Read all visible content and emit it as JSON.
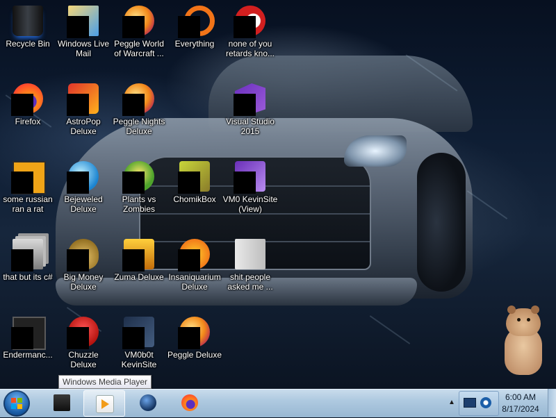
{
  "desktop": {
    "icons": [
      {
        "label_lines": [
          "Recycle Bin"
        ],
        "icon": "recycle-bin-icon"
      },
      {
        "label_lines": [
          "Windows Live",
          "Mail"
        ],
        "icon": "windows-live-mail-icon"
      },
      {
        "label_lines": [
          "Peggle World",
          "of Warcraft ..."
        ],
        "icon": "peggle-icon"
      },
      {
        "label_lines": [
          "Everything"
        ],
        "icon": "everything-search-icon"
      },
      {
        "label_lines": [
          "none of you",
          "retards kno..."
        ],
        "icon": "shortcut-icon"
      },
      {
        "label_lines": [
          "Firefox"
        ],
        "icon": "firefox-icon"
      },
      {
        "label_lines": [
          "AstroPop",
          "Deluxe"
        ],
        "icon": "astropop-icon"
      },
      {
        "label_lines": [
          "Peggle Nights",
          "Deluxe"
        ],
        "icon": "peggle-nights-icon"
      },
      {
        "label_lines": [
          "Visual Studio",
          "2015"
        ],
        "icon": "visual-studio-icon"
      },
      {
        "label_lines": [
          "some russian",
          "ran a rat"
        ],
        "icon": "file-icon"
      },
      {
        "label_lines": [
          "Bejeweled",
          "Deluxe"
        ],
        "icon": "bejeweled-icon"
      },
      {
        "label_lines": [
          "Plants vs",
          "Zombies"
        ],
        "icon": "plants-vs-zombies-icon"
      },
      {
        "label_lines": [
          "ChomikBox"
        ],
        "icon": "chomikbox-icon"
      },
      {
        "label_lines": [
          "VM0 KevinSite",
          "(View)"
        ],
        "icon": "vm-icon"
      },
      {
        "label_lines": [
          "that but its c#"
        ],
        "icon": "stacked-files-icon"
      },
      {
        "label_lines": [
          "Big Money",
          "Deluxe"
        ],
        "icon": "big-money-icon"
      },
      {
        "label_lines": [
          "Zuma Deluxe"
        ],
        "icon": "zuma-icon"
      },
      {
        "label_lines": [
          "Insaniquarium",
          "Deluxe"
        ],
        "icon": "insaniquarium-icon"
      },
      {
        "label_lines": [
          "shit people",
          "asked me ..."
        ],
        "icon": "folder-icon"
      },
      {
        "label_lines": [
          "Endermanc..."
        ],
        "icon": "console-icon"
      },
      {
        "label_lines": [
          "Chuzzle",
          "Deluxe"
        ],
        "icon": "chuzzle-icon"
      },
      {
        "label_lines": [
          "VM0b0t",
          "KevinSite"
        ],
        "icon": "vm-icon"
      },
      {
        "label_lines": [
          "Peggle Deluxe"
        ],
        "icon": "peggle-icon"
      }
    ]
  },
  "tooltip": {
    "text": "Windows Media Player"
  },
  "taskbar": {
    "start_icon": "windows-start-orb-icon",
    "pinned": [
      {
        "name": "monitor",
        "icon": "monitor-icon"
      },
      {
        "name": "windows-media-player",
        "icon": "windows-media-player-icon",
        "active": true
      },
      {
        "name": "globe",
        "icon": "globe-icon"
      },
      {
        "name": "firefox",
        "icon": "firefox-icon"
      }
    ],
    "tray": {
      "show_hidden_glyph": "▲"
    },
    "clock": {
      "time": "6:00 AM",
      "date": "8/17/2024"
    }
  }
}
